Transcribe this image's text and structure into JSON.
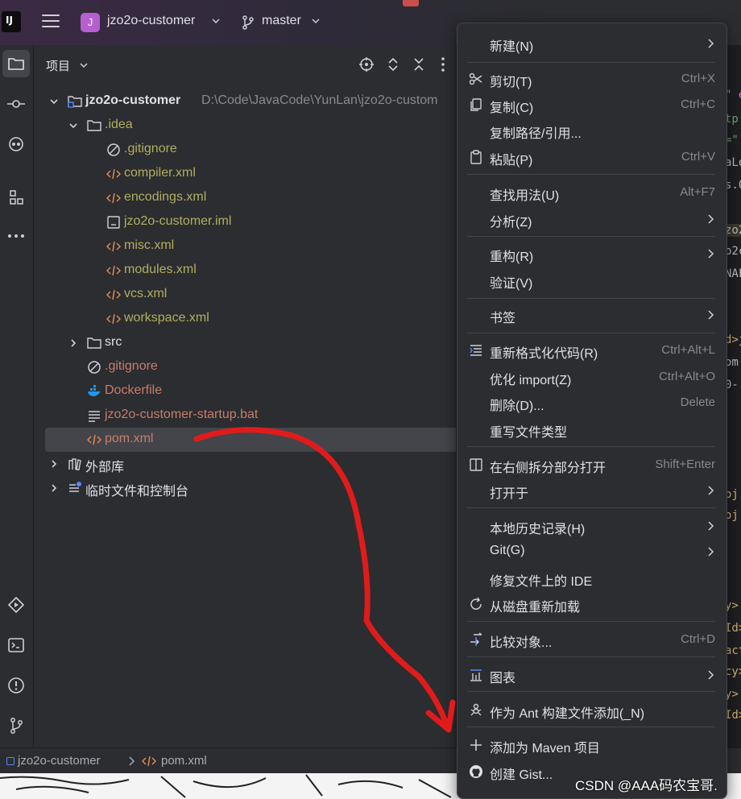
{
  "titlebar": {
    "project_initial": "J",
    "project_name": "jzo2o-customer",
    "branch": "master"
  },
  "panel": {
    "title": "项目"
  },
  "tree": [
    {
      "label": "jzo2o-customer",
      "hint": "D:\\Code\\JavaCode\\YunLan\\jzo2o-custom",
      "icon": "module-folder-icon"
    },
    {
      "label": ".idea",
      "icon": "folder-icon"
    },
    {
      "label": ".gitignore",
      "icon": "ignore-file-icon"
    },
    {
      "label": "compiler.xml",
      "icon": "xml-file-icon"
    },
    {
      "label": "encodings.xml",
      "icon": "xml-file-icon"
    },
    {
      "label": "jzo2o-customer.iml",
      "icon": "iml-file-icon"
    },
    {
      "label": "misc.xml",
      "icon": "xml-file-icon"
    },
    {
      "label": "modules.xml",
      "icon": "xml-file-icon"
    },
    {
      "label": "vcs.xml",
      "icon": "xml-file-icon"
    },
    {
      "label": "workspace.xml",
      "icon": "xml-file-icon"
    },
    {
      "label": "src",
      "icon": "folder-icon"
    },
    {
      "label": ".gitignore",
      "icon": "ignore-file-icon"
    },
    {
      "label": "Dockerfile",
      "icon": "docker-icon"
    },
    {
      "label": "jzo2o-customer-startup.bat",
      "icon": "text-file-icon"
    },
    {
      "label": "pom.xml",
      "icon": "xml-file-icon"
    },
    {
      "label": "外部库",
      "icon": "library-icon"
    },
    {
      "label": "临时文件和控制台",
      "icon": "scratches-icon"
    }
  ],
  "menu": {
    "items": [
      {
        "label": "新建(N)",
        "shortcut": ""
      },
      {
        "label": "剪切(T)",
        "shortcut": "Ctrl+X"
      },
      {
        "label": "复制(C)",
        "shortcut": "Ctrl+C"
      },
      {
        "label": "复制路径/引用...",
        "shortcut": ""
      },
      {
        "label": "粘贴(P)",
        "shortcut": "Ctrl+V"
      },
      {
        "label": "查找用法(U)",
        "shortcut": "Alt+F7"
      },
      {
        "label": "分析(Z)",
        "shortcut": ""
      },
      {
        "label": "重构(R)",
        "shortcut": ""
      },
      {
        "label": "验证(V)",
        "shortcut": ""
      },
      {
        "label": "书签",
        "shortcut": ""
      },
      {
        "label": "重新格式化代码(R)",
        "shortcut": "Ctrl+Alt+L"
      },
      {
        "label": "优化 import(Z)",
        "shortcut": "Ctrl+Alt+O"
      },
      {
        "label": "删除(D)...",
        "shortcut": "Delete"
      },
      {
        "label": "重写文件类型",
        "shortcut": ""
      },
      {
        "label": "在右侧拆分部分打开",
        "shortcut": "Shift+Enter"
      },
      {
        "label": "打开于",
        "shortcut": ""
      },
      {
        "label": "本地历史记录(H)",
        "shortcut": ""
      },
      {
        "label": "Git(G)",
        "shortcut": ""
      },
      {
        "label": "修复文件上的 IDE",
        "shortcut": ""
      },
      {
        "label": "从磁盘重新加载",
        "shortcut": ""
      },
      {
        "label": "比较对象...",
        "shortcut": "Ctrl+D"
      },
      {
        "label": "图表",
        "shortcut": ""
      },
      {
        "label": "作为 Ant 构建文件添加(_N)",
        "shortcut": ""
      },
      {
        "label": "添加为 Maven 项目",
        "shortcut": ""
      },
      {
        "label": "创建 Gist...",
        "shortcut": ""
      }
    ]
  },
  "editor_fragments": [
    "\" e",
    "tp",
    "=\"",
    "aLo",
    "s.0",
    "zo2",
    "o2c",
    "NAF",
    "d>j",
    "om.",
    "0-",
    "oj",
    "oj",
    "y>",
    "Id>",
    "act",
    "cy>",
    "y>",
    "Id>"
  ],
  "statusbar": {
    "project": "jzo2o-customer",
    "file": "pom.xml"
  },
  "watermark": "CSDN @AAA码农宝哥.",
  "colors": {
    "accent_red_arrow": "#e01b1b",
    "project_badge": "#b65fd1",
    "xml_file_text": "#b3ae60",
    "modified_file_text": "#c77d6b"
  }
}
